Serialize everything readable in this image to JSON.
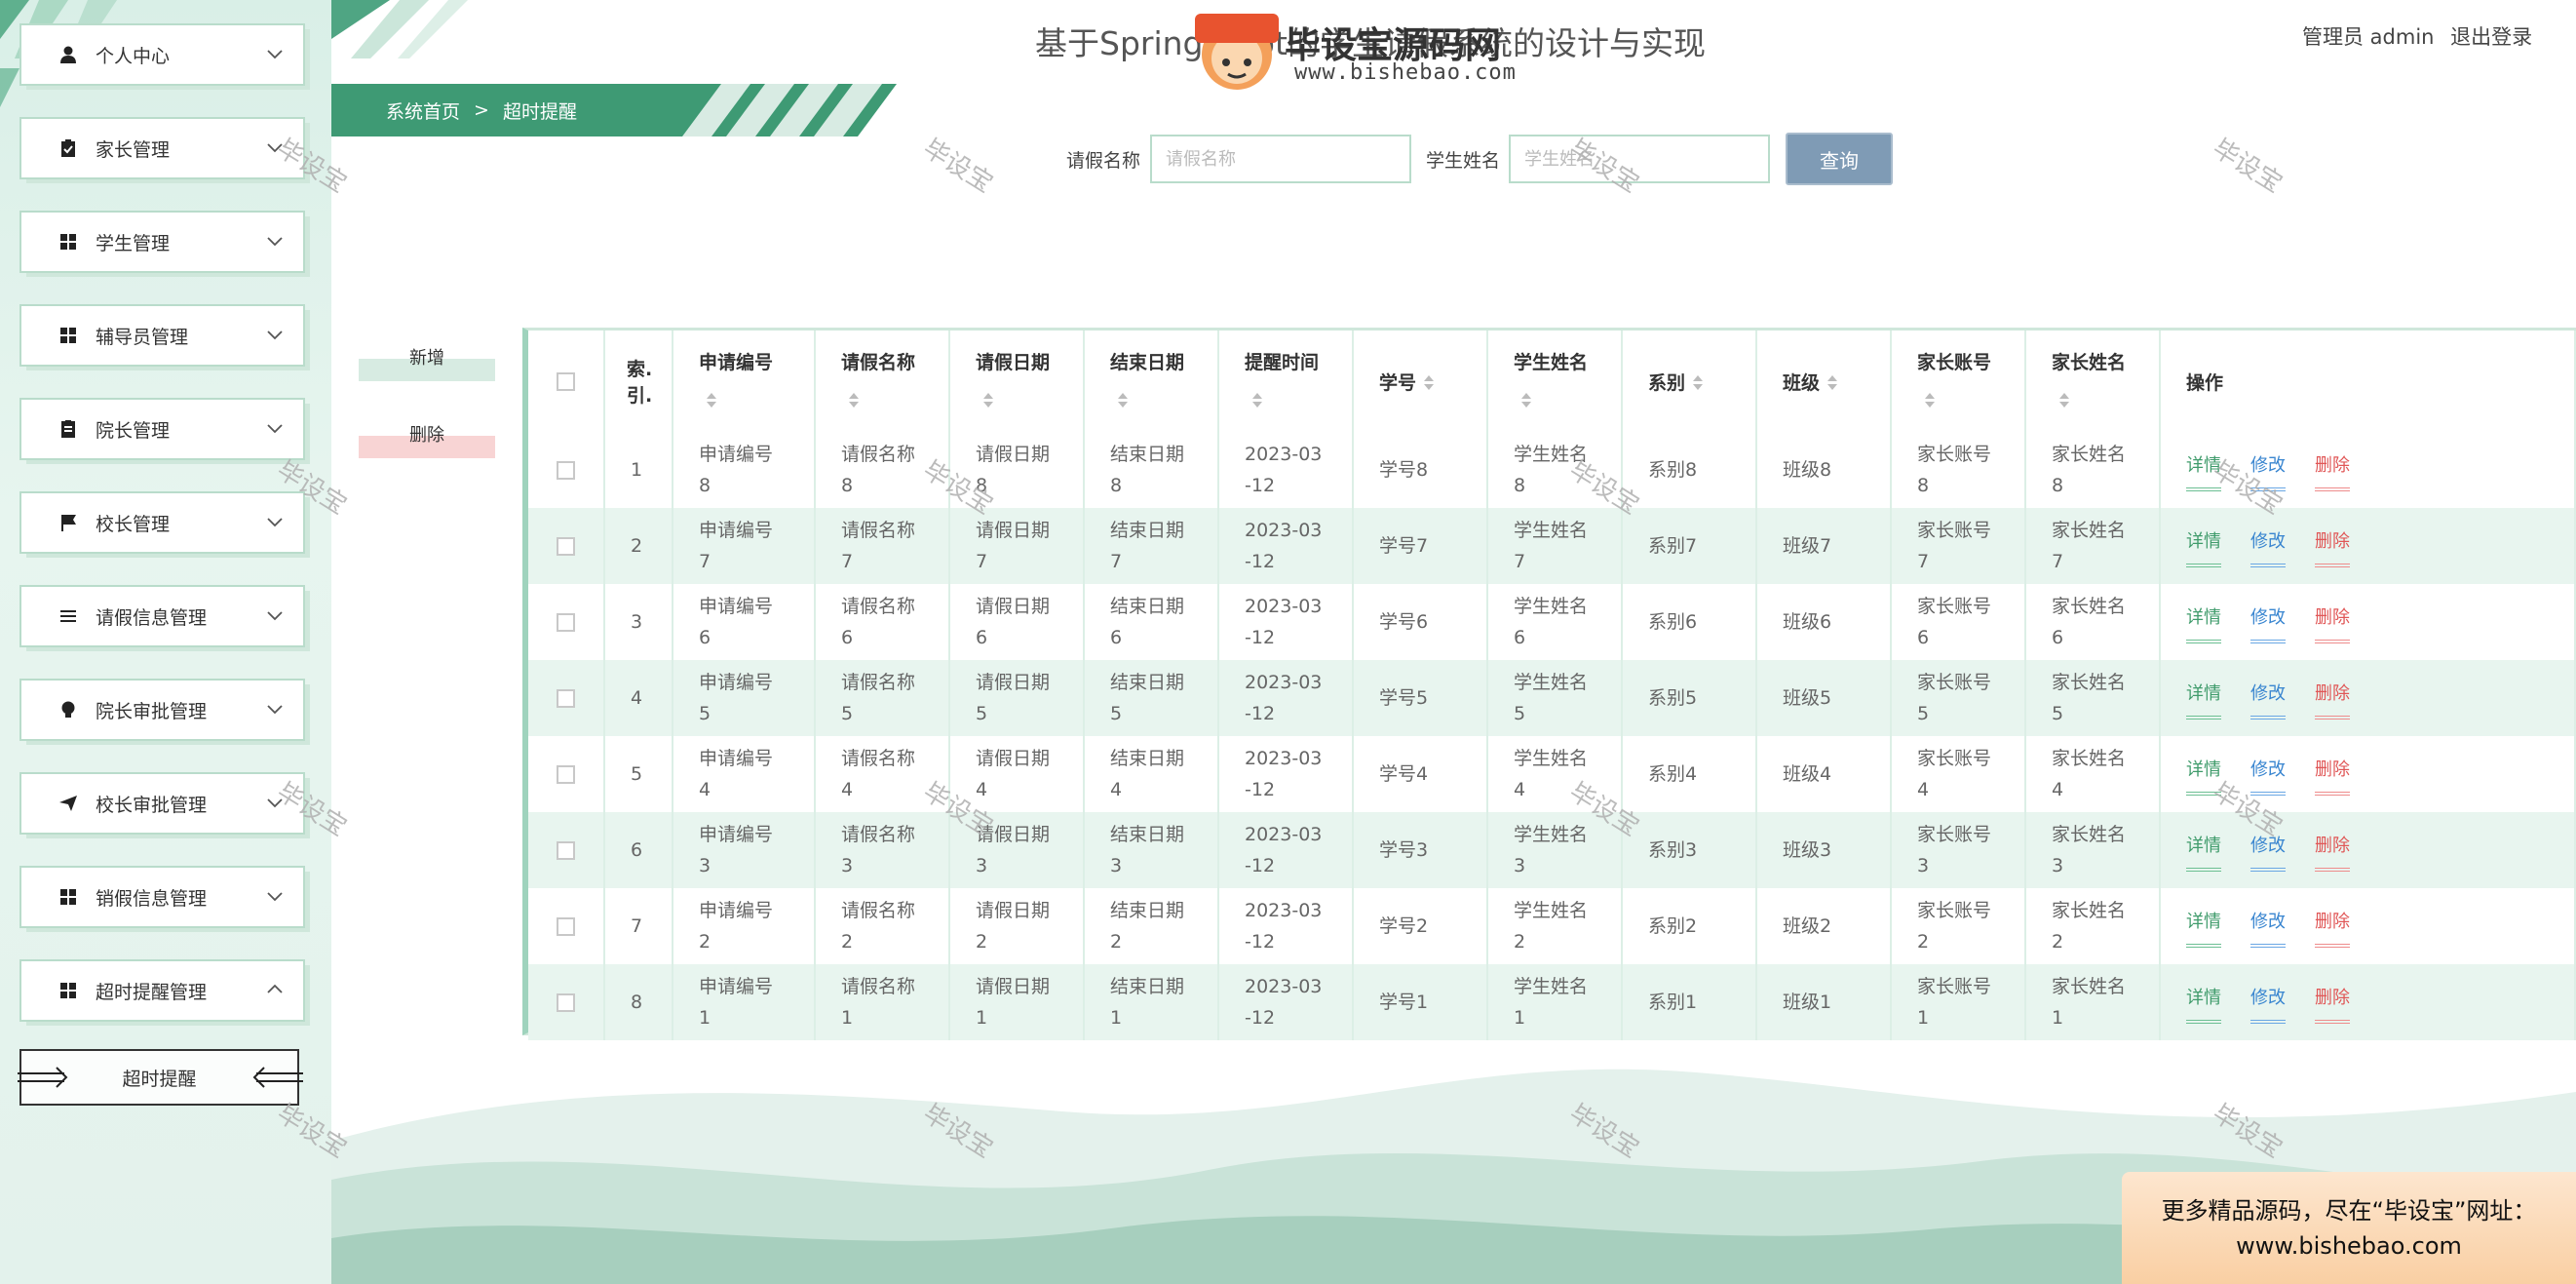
{
  "site": {
    "title": "基于Spring Boot的学生请假系统的设计与实现",
    "user_role": "管理员 admin",
    "logout_label": "退出登录"
  },
  "watermark": {
    "brand": "毕设宝源码网",
    "logo_text": "毕设宝",
    "url": "www.bishebao.com",
    "stamp": "毕设宝"
  },
  "breadcrumb": {
    "home": "系统首页",
    "separator": ">",
    "current": "超时提醒"
  },
  "sidebar": {
    "items": [
      {
        "label": "个人中心",
        "icon": "user-icon"
      },
      {
        "label": "家长管理",
        "icon": "clipboard-icon"
      },
      {
        "label": "学生管理",
        "icon": "grid-icon"
      },
      {
        "label": "辅导员管理",
        "icon": "grid-icon"
      },
      {
        "label": "院长管理",
        "icon": "document-icon"
      },
      {
        "label": "校长管理",
        "icon": "flag-icon"
      },
      {
        "label": "请假信息管理",
        "icon": "list-icon"
      },
      {
        "label": "院长审批管理",
        "icon": "bulb-icon"
      },
      {
        "label": "校长审批管理",
        "icon": "send-icon"
      },
      {
        "label": "销假信息管理",
        "icon": "grid-icon"
      },
      {
        "label": "超时提醒管理",
        "icon": "grid-icon"
      }
    ],
    "sub_item": "超时提醒"
  },
  "search": {
    "leave_name_label": "请假名称",
    "leave_name_placeholder": "请假名称",
    "student_name_label": "学生姓名",
    "student_name_placeholder": "学生姓名",
    "query_label": "查询"
  },
  "actions": {
    "add_label": "新增",
    "delete_label": "删除"
  },
  "table": {
    "headers": {
      "index": "索引",
      "apply_no": "申请编号",
      "leave_name": "请假名称",
      "leave_date": "请假日期",
      "end_date": "结束日期",
      "remind_time": "提醒时间",
      "student_no": "学号",
      "student_name": "学生姓名",
      "department": "系别",
      "class": "班级",
      "parent_account": "家长账号",
      "parent_name": "家长姓名",
      "operation": "操作"
    },
    "row_actions": {
      "detail": "详情",
      "edit": "修改",
      "delete": "删除"
    },
    "rows": [
      {
        "index": "1",
        "apply_no": "申请编号8",
        "leave_name": "请假名称8",
        "leave_date": "请假日期8",
        "end_date": "结束日期8",
        "remind_time": "2023-03-12",
        "student_no": "学号8",
        "student_name": "学生姓名8",
        "department": "系别8",
        "class": "班级8",
        "parent_account": "家长账号8",
        "parent_name": "家长姓名8"
      },
      {
        "index": "2",
        "apply_no": "申请编号7",
        "leave_name": "请假名称7",
        "leave_date": "请假日期7",
        "end_date": "结束日期7",
        "remind_time": "2023-03-12",
        "student_no": "学号7",
        "student_name": "学生姓名7",
        "department": "系别7",
        "class": "班级7",
        "parent_account": "家长账号7",
        "parent_name": "家长姓名7"
      },
      {
        "index": "3",
        "apply_no": "申请编号6",
        "leave_name": "请假名称6",
        "leave_date": "请假日期6",
        "end_date": "结束日期6",
        "remind_time": "2023-03-12",
        "student_no": "学号6",
        "student_name": "学生姓名6",
        "department": "系别6",
        "class": "班级6",
        "parent_account": "家长账号6",
        "parent_name": "家长姓名6"
      },
      {
        "index": "4",
        "apply_no": "申请编号5",
        "leave_name": "请假名称5",
        "leave_date": "请假日期5",
        "end_date": "结束日期5",
        "remind_time": "2023-03-12",
        "student_no": "学号5",
        "student_name": "学生姓名5",
        "department": "系别5",
        "class": "班级5",
        "parent_account": "家长账号5",
        "parent_name": "家长姓名5"
      },
      {
        "index": "5",
        "apply_no": "申请编号4",
        "leave_name": "请假名称4",
        "leave_date": "请假日期4",
        "end_date": "结束日期4",
        "remind_time": "2023-03-12",
        "student_no": "学号4",
        "student_name": "学生姓名4",
        "department": "系别4",
        "class": "班级4",
        "parent_account": "家长账号4",
        "parent_name": "家长姓名4"
      },
      {
        "index": "6",
        "apply_no": "申请编号3",
        "leave_name": "请假名称3",
        "leave_date": "请假日期3",
        "end_date": "结束日期3",
        "remind_time": "2023-03-12",
        "student_no": "学号3",
        "student_name": "学生姓名3",
        "department": "系别3",
        "class": "班级3",
        "parent_account": "家长账号3",
        "parent_name": "家长姓名3"
      },
      {
        "index": "7",
        "apply_no": "申请编号2",
        "leave_name": "请假名称2",
        "leave_date": "请假日期2",
        "end_date": "结束日期2",
        "remind_time": "2023-03-12",
        "student_no": "学号2",
        "student_name": "学生姓名2",
        "department": "系别2",
        "class": "班级2",
        "parent_account": "家长账号2",
        "parent_name": "家长姓名2"
      },
      {
        "index": "8",
        "apply_no": "申请编号1",
        "leave_name": "请假名称1",
        "leave_date": "请假日期1",
        "end_date": "结束日期1",
        "remind_time": "2023-03-12",
        "student_no": "学号1",
        "student_name": "学生姓名1",
        "department": "系别1",
        "class": "班级1",
        "parent_account": "家长账号1",
        "parent_name": "家长姓名1"
      }
    ]
  },
  "ad": {
    "line1": "更多精品源码，尽在“毕设宝”网址：",
    "line2": "www.bishebao.com"
  },
  "colors": {
    "accent": "#3f9b6b",
    "sidebar_bg": "#e3f2ec",
    "query_button": "#7f9bb5",
    "delete_red": "#e05656",
    "edit_blue": "#3a86d0"
  }
}
